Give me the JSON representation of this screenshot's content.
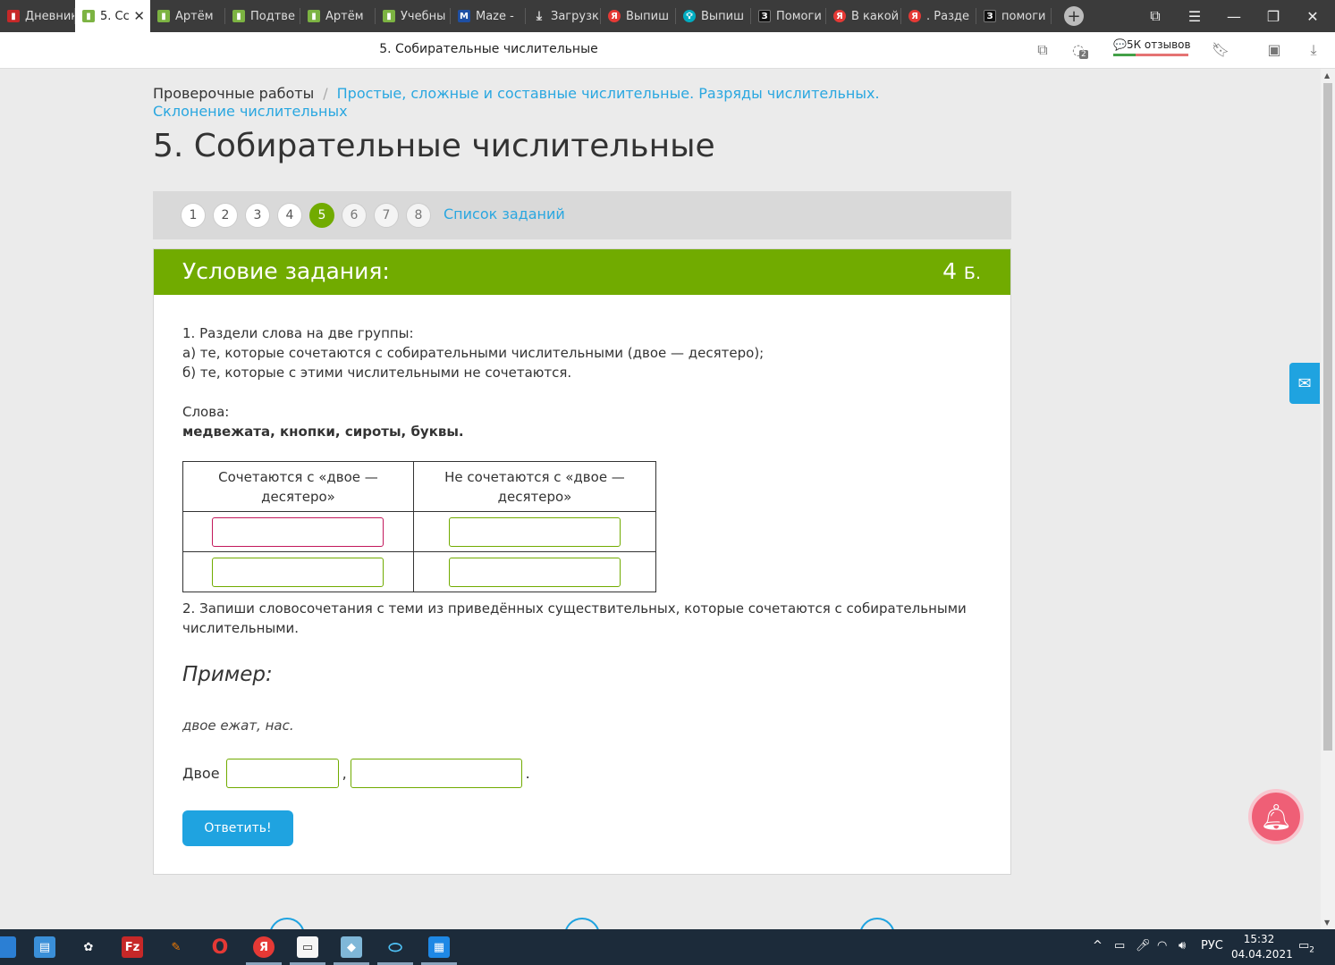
{
  "tabs": [
    {
      "label": "Дневник",
      "icon": "red-book-icon"
    },
    {
      "label": "5. Сс",
      "icon": "green-book-icon",
      "active": true
    },
    {
      "label": "Артём",
      "icon": "green-book-icon"
    },
    {
      "label": "Подтве",
      "icon": "green-book-icon"
    },
    {
      "label": "Артём",
      "icon": "green-book-icon"
    },
    {
      "label": "Учебны",
      "icon": "green-book-icon"
    },
    {
      "label": "Maze -",
      "icon": "maze-icon"
    },
    {
      "label": "Загрузк",
      "icon": "download-icon"
    },
    {
      "label": "Выпиш",
      "icon": "yandex-icon"
    },
    {
      "label": "Выпиш",
      "icon": "bulb-icon"
    },
    {
      "label": "Помоги",
      "icon": "z-icon"
    },
    {
      "label": "В какой",
      "icon": "yandex-icon"
    },
    {
      "label": ". Разде",
      "icon": "yandex-icon"
    },
    {
      "label": "помоги",
      "icon": "z-icon"
    }
  ],
  "address_bar": {
    "title": "5. Собирательные числительные",
    "notif_count": "2",
    "reviews": "5К отзывов"
  },
  "breadcrumb": {
    "root": "Проверочные работы",
    "separator": "/",
    "current": "Простые, сложные и составные числительные. Разряды числительных. Склонение числительных"
  },
  "page_title": "5. Собирательные числительные",
  "pager": {
    "pages": [
      "1",
      "2",
      "3",
      "4",
      "5",
      "6",
      "7",
      "8"
    ],
    "active_page": "5",
    "list_link": "Список заданий"
  },
  "task": {
    "header": "Условие задания:",
    "points": "4",
    "points_unit": "Б.",
    "instr_line1": "1. Раздели слова на две группы:",
    "instr_line2": "а) те, которые сочетаются с собирательными числительными (двое — десятеро);",
    "instr_line3": "б) те, которые с этими числительными не сочетаются.",
    "words_label": "Слова:",
    "words": "медвежата, кнопки, сироты, буквы.",
    "table": {
      "col1": "Сочетаются с «двое — десятеро»",
      "col2": "Не сочетаются с «двое — десятеро»"
    },
    "instr2": "2. Запиши словосочетания с теми из приведённых существительных, которые сочетаются с собирательными числительными.",
    "example_heading": "Пример:",
    "example_text": "двое ежат, нас.",
    "answer_prefix": "Двое",
    "answer_comma": ",",
    "answer_period": ".",
    "submit": "Ответить!"
  },
  "taskbar": {
    "lang": "РУС",
    "time": "15:32",
    "date": "04.04.2021",
    "notif_badge": "2"
  }
}
